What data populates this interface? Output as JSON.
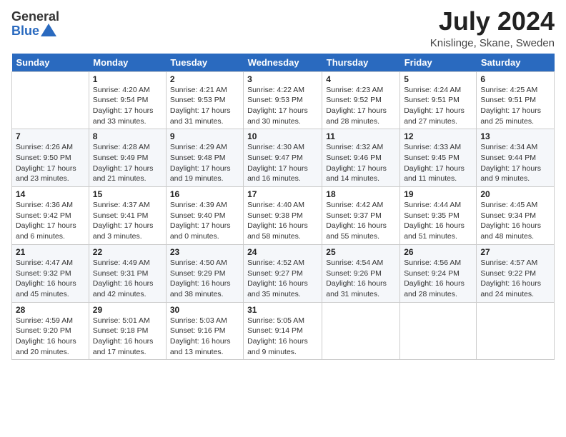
{
  "logo": {
    "general": "General",
    "blue": "Blue"
  },
  "header": {
    "month_year": "July 2024",
    "location": "Knislinge, Skane, Sweden"
  },
  "weekdays": [
    "Sunday",
    "Monday",
    "Tuesday",
    "Wednesday",
    "Thursday",
    "Friday",
    "Saturday"
  ],
  "weeks": [
    [
      {
        "day": "",
        "info": ""
      },
      {
        "day": "1",
        "info": "Sunrise: 4:20 AM\nSunset: 9:54 PM\nDaylight: 17 hours and 33 minutes."
      },
      {
        "day": "2",
        "info": "Sunrise: 4:21 AM\nSunset: 9:53 PM\nDaylight: 17 hours and 31 minutes."
      },
      {
        "day": "3",
        "info": "Sunrise: 4:22 AM\nSunset: 9:53 PM\nDaylight: 17 hours and 30 minutes."
      },
      {
        "day": "4",
        "info": "Sunrise: 4:23 AM\nSunset: 9:52 PM\nDaylight: 17 hours and 28 minutes."
      },
      {
        "day": "5",
        "info": "Sunrise: 4:24 AM\nSunset: 9:51 PM\nDaylight: 17 hours and 27 minutes."
      },
      {
        "day": "6",
        "info": "Sunrise: 4:25 AM\nSunset: 9:51 PM\nDaylight: 17 hours and 25 minutes."
      }
    ],
    [
      {
        "day": "7",
        "info": "Sunrise: 4:26 AM\nSunset: 9:50 PM\nDaylight: 17 hours and 23 minutes."
      },
      {
        "day": "8",
        "info": "Sunrise: 4:28 AM\nSunset: 9:49 PM\nDaylight: 17 hours and 21 minutes."
      },
      {
        "day": "9",
        "info": "Sunrise: 4:29 AM\nSunset: 9:48 PM\nDaylight: 17 hours and 19 minutes."
      },
      {
        "day": "10",
        "info": "Sunrise: 4:30 AM\nSunset: 9:47 PM\nDaylight: 17 hours and 16 minutes."
      },
      {
        "day": "11",
        "info": "Sunrise: 4:32 AM\nSunset: 9:46 PM\nDaylight: 17 hours and 14 minutes."
      },
      {
        "day": "12",
        "info": "Sunrise: 4:33 AM\nSunset: 9:45 PM\nDaylight: 17 hours and 11 minutes."
      },
      {
        "day": "13",
        "info": "Sunrise: 4:34 AM\nSunset: 9:44 PM\nDaylight: 17 hours and 9 minutes."
      }
    ],
    [
      {
        "day": "14",
        "info": "Sunrise: 4:36 AM\nSunset: 9:42 PM\nDaylight: 17 hours and 6 minutes."
      },
      {
        "day": "15",
        "info": "Sunrise: 4:37 AM\nSunset: 9:41 PM\nDaylight: 17 hours and 3 minutes."
      },
      {
        "day": "16",
        "info": "Sunrise: 4:39 AM\nSunset: 9:40 PM\nDaylight: 17 hours and 0 minutes."
      },
      {
        "day": "17",
        "info": "Sunrise: 4:40 AM\nSunset: 9:38 PM\nDaylight: 16 hours and 58 minutes."
      },
      {
        "day": "18",
        "info": "Sunrise: 4:42 AM\nSunset: 9:37 PM\nDaylight: 16 hours and 55 minutes."
      },
      {
        "day": "19",
        "info": "Sunrise: 4:44 AM\nSunset: 9:35 PM\nDaylight: 16 hours and 51 minutes."
      },
      {
        "day": "20",
        "info": "Sunrise: 4:45 AM\nSunset: 9:34 PM\nDaylight: 16 hours and 48 minutes."
      }
    ],
    [
      {
        "day": "21",
        "info": "Sunrise: 4:47 AM\nSunset: 9:32 PM\nDaylight: 16 hours and 45 minutes."
      },
      {
        "day": "22",
        "info": "Sunrise: 4:49 AM\nSunset: 9:31 PM\nDaylight: 16 hours and 42 minutes."
      },
      {
        "day": "23",
        "info": "Sunrise: 4:50 AM\nSunset: 9:29 PM\nDaylight: 16 hours and 38 minutes."
      },
      {
        "day": "24",
        "info": "Sunrise: 4:52 AM\nSunset: 9:27 PM\nDaylight: 16 hours and 35 minutes."
      },
      {
        "day": "25",
        "info": "Sunrise: 4:54 AM\nSunset: 9:26 PM\nDaylight: 16 hours and 31 minutes."
      },
      {
        "day": "26",
        "info": "Sunrise: 4:56 AM\nSunset: 9:24 PM\nDaylight: 16 hours and 28 minutes."
      },
      {
        "day": "27",
        "info": "Sunrise: 4:57 AM\nSunset: 9:22 PM\nDaylight: 16 hours and 24 minutes."
      }
    ],
    [
      {
        "day": "28",
        "info": "Sunrise: 4:59 AM\nSunset: 9:20 PM\nDaylight: 16 hours and 20 minutes."
      },
      {
        "day": "29",
        "info": "Sunrise: 5:01 AM\nSunset: 9:18 PM\nDaylight: 16 hours and 17 minutes."
      },
      {
        "day": "30",
        "info": "Sunrise: 5:03 AM\nSunset: 9:16 PM\nDaylight: 16 hours and 13 minutes."
      },
      {
        "day": "31",
        "info": "Sunrise: 5:05 AM\nSunset: 9:14 PM\nDaylight: 16 hours and 9 minutes."
      },
      {
        "day": "",
        "info": ""
      },
      {
        "day": "",
        "info": ""
      },
      {
        "day": "",
        "info": ""
      }
    ]
  ]
}
